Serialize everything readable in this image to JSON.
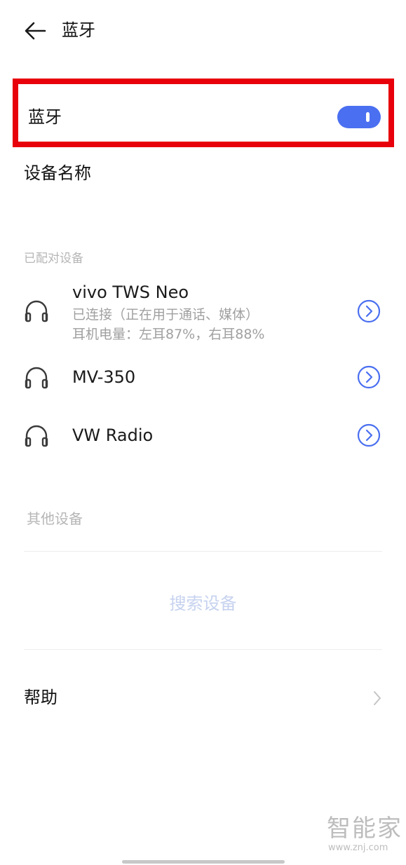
{
  "header": {
    "title": "蓝牙",
    "back_icon": "arrow-left-icon"
  },
  "bluetooth": {
    "label": "蓝牙",
    "enabled": true,
    "accent": "#4a6ff0",
    "highlight_color": "#e8000b"
  },
  "device_name": {
    "label": "设备名称"
  },
  "paired_section": {
    "title": "已配对设备",
    "devices": [
      {
        "name": "vivo TWS Neo",
        "status": "已连接（正在用于通话、媒体）",
        "battery": "耳机电量：左耳87%，右耳88%",
        "icon": "headphones-icon"
      },
      {
        "name": "MV-350",
        "icon": "headphones-icon"
      },
      {
        "name": "VW Radio",
        "icon": "headphones-icon"
      }
    ]
  },
  "other_section": {
    "title": "其他设备",
    "search_label": "搜索设备"
  },
  "help": {
    "label": "帮助"
  },
  "watermark": {
    "logo": "智能家",
    "url": "www.znj.com"
  }
}
